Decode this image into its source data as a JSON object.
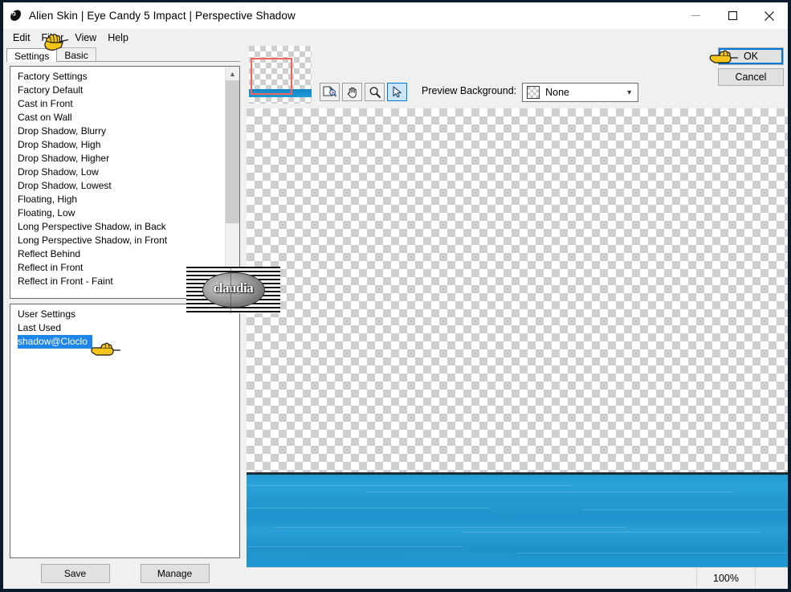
{
  "window": {
    "title": "Alien Skin | Eye Candy 5 Impact | Perspective Shadow",
    "app_icon": "alien-skin-icon",
    "controls": {
      "minimize": "minimize-icon",
      "maximize": "maximize-icon",
      "close": "close-icon"
    }
  },
  "menubar": {
    "items": [
      {
        "label": "Edit"
      },
      {
        "label": "Filter"
      },
      {
        "label": "View"
      },
      {
        "label": "Help"
      }
    ]
  },
  "tabs": [
    {
      "label": "Settings",
      "active": true
    },
    {
      "label": "Basic",
      "active": false
    }
  ],
  "settings_list": {
    "scrollbar": {
      "up_arrow": "chevron-up-icon"
    },
    "items": [
      {
        "label": "Factory Settings",
        "selected": false
      },
      {
        "label": "Factory Default",
        "selected": false
      },
      {
        "label": "Cast in Front",
        "selected": false
      },
      {
        "label": "Cast on Wall",
        "selected": false
      },
      {
        "label": "Drop Shadow, Blurry",
        "selected": false
      },
      {
        "label": "Drop Shadow, High",
        "selected": false
      },
      {
        "label": "Drop Shadow, Higher",
        "selected": false
      },
      {
        "label": "Drop Shadow, Low",
        "selected": false
      },
      {
        "label": "Drop Shadow, Lowest",
        "selected": false
      },
      {
        "label": "Floating, High",
        "selected": false
      },
      {
        "label": "Floating, Low",
        "selected": false
      },
      {
        "label": "Long Perspective Shadow, in Back",
        "selected": false
      },
      {
        "label": "Long Perspective Shadow, in Front",
        "selected": false
      },
      {
        "label": "Reflect Behind",
        "selected": false
      },
      {
        "label": "Reflect in Front",
        "selected": false
      },
      {
        "label": "Reflect in Front - Faint",
        "selected": false
      }
    ]
  },
  "user_settings_list": {
    "items": [
      {
        "label": "User Settings",
        "selected": false
      },
      {
        "label": "Last Used",
        "selected": false
      },
      {
        "label": "shadow@Cloclo",
        "selected": true
      }
    ]
  },
  "left_buttons": {
    "save": "Save",
    "manage": "Manage"
  },
  "preview_toolbar": {
    "navigator": "navigator-thumbnail",
    "tools": [
      {
        "name": "fit-image-tool",
        "icon": "fit-image-icon",
        "active": false
      },
      {
        "name": "pan-tool",
        "icon": "hand-icon",
        "active": false
      },
      {
        "name": "zoom-tool",
        "icon": "magnifier-icon",
        "active": false
      },
      {
        "name": "select-tool",
        "icon": "arrow-pointer-icon",
        "active": true
      }
    ],
    "preview_background_label": "Preview Background:",
    "preview_background_value": "None",
    "dropdown_arrow": "chevron-down-icon"
  },
  "dialog_buttons": {
    "ok": "OK",
    "cancel": "Cancel"
  },
  "statusbar": {
    "zoom": "100%"
  },
  "watermark": {
    "text": "claudia",
    "subtext": "vos tubes"
  },
  "cursors": [
    {
      "name": "pointing-hand-filter"
    },
    {
      "name": "pointing-hand-shadow-cloclo"
    },
    {
      "name": "pointing-hand-ok"
    }
  ],
  "colors": {
    "accent": "#0078d7",
    "selection": "#1e86e8",
    "viewport_rect": "#f4645a",
    "water": "#1f9ad1",
    "window_border": "#0a1a2a"
  }
}
